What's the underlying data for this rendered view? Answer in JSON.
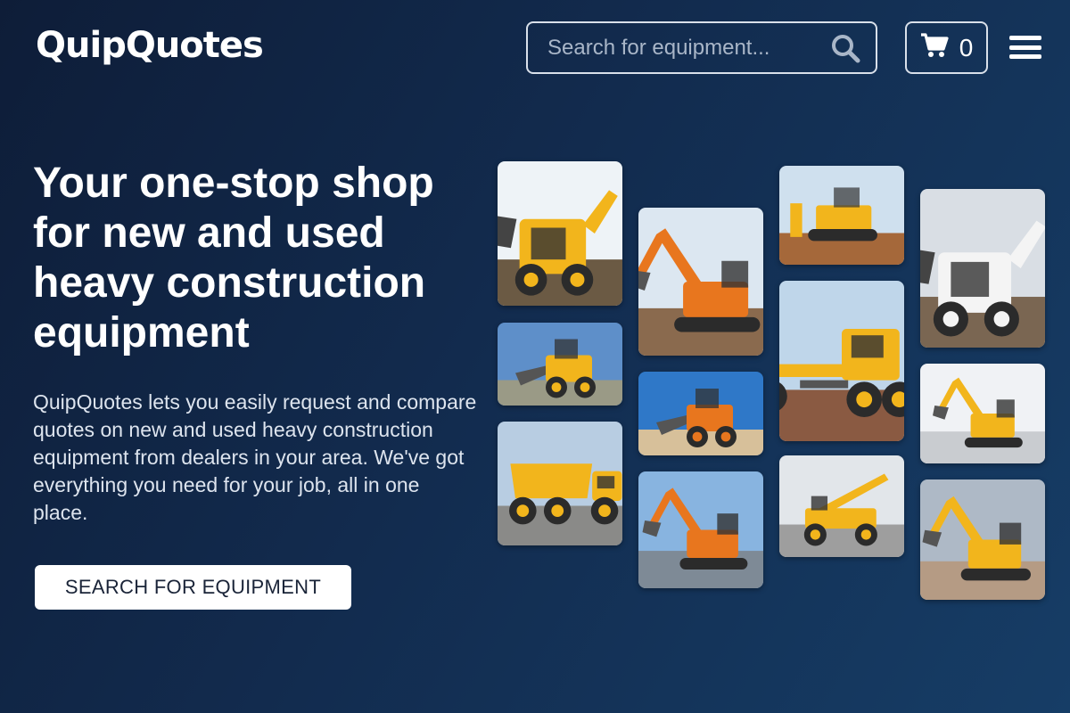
{
  "header": {
    "logo": "QuipQuotes",
    "search_placeholder": "Search for equipment...",
    "cart_count": "0"
  },
  "hero": {
    "title": "Your one-stop shop for new and used heavy construction equipment",
    "description": "QuipQuotes lets you easily request and compare quotes on new and used heavy construction equipment from dealers in your area. We've got everything you need for your job, all in one place.",
    "cta_label": "SEARCH FOR EQUIPMENT"
  },
  "colors": {
    "background_start": "#0e1d38",
    "background_end": "#163d66",
    "accent_yellow": "#f2b51c",
    "orange": "#e8761e"
  },
  "gallery": [
    {
      "name": "skid-steer-loader-tile",
      "sky": "#eef3f7",
      "ground": "#6b5a44",
      "machine": "#f2b51c",
      "kind": "skidsteer"
    },
    {
      "name": "compact-loader-hay-tile",
      "sky": "#5e8fc9",
      "ground": "#9a9a86",
      "machine": "#f2b51c",
      "kind": "loader"
    },
    {
      "name": "articulated-dump-truck-tile",
      "sky": "#b8cde2",
      "ground": "#8a8a88",
      "machine": "#f2b51c",
      "kind": "truck"
    },
    {
      "name": "mini-excavator-tile",
      "sky": "#dce7f1",
      "ground": "#8a6a4e",
      "machine": "#e8761e",
      "kind": "excavator"
    },
    {
      "name": "wheel-loader-tile",
      "sky": "#2f78c8",
      "ground": "#d7c09a",
      "machine": "#e8761e",
      "kind": "loader"
    },
    {
      "name": "excavator-gravel-tile",
      "sky": "#88b4e0",
      "ground": "#7e8a96",
      "machine": "#e8761e",
      "kind": "excavator"
    },
    {
      "name": "crawler-dozer-tile",
      "sky": "#cfe0ee",
      "ground": "#a5683a",
      "machine": "#f2b51c",
      "kind": "dozer"
    },
    {
      "name": "motor-grader-tile",
      "sky": "#bfd6ea",
      "ground": "#8a5a42",
      "machine": "#f2b51c",
      "kind": "grader"
    },
    {
      "name": "telehandler-tile",
      "sky": "#e2e6ea",
      "ground": "#9e9e9e",
      "machine": "#f2b51c",
      "kind": "telehandler"
    },
    {
      "name": "white-skid-steer-tile",
      "sky": "#d9dee4",
      "ground": "#7a6652",
      "machine": "#f4f4f4",
      "kind": "skidsteer"
    },
    {
      "name": "large-excavator-tile",
      "sky": "#f0f2f5",
      "ground": "#c9ccd0",
      "machine": "#f2b51c",
      "kind": "excavator"
    },
    {
      "name": "jcb-excavator-tile",
      "sky": "#aeb9c6",
      "ground": "#b59b84",
      "machine": "#f2b51c",
      "kind": "excavator"
    }
  ]
}
